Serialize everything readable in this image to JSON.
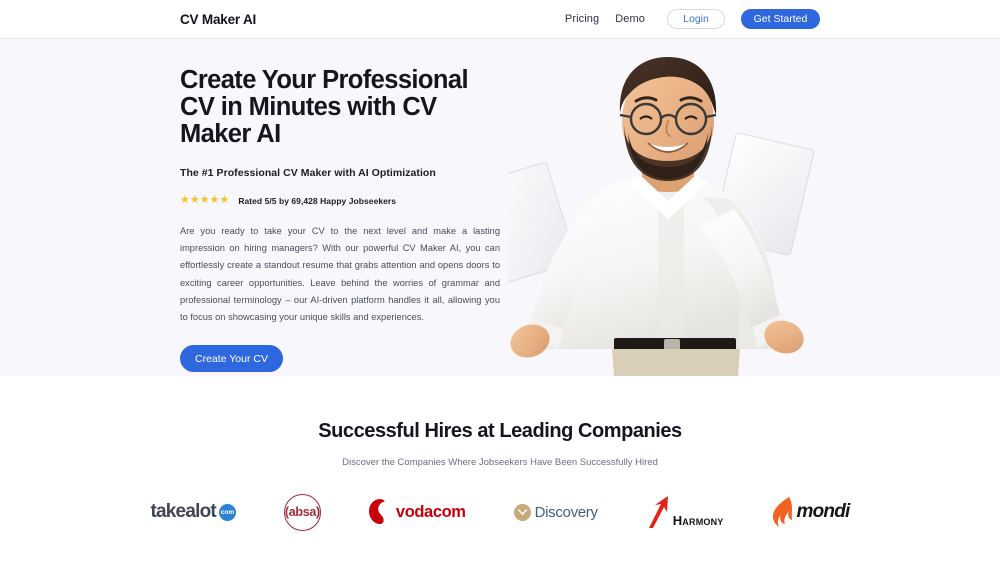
{
  "colors": {
    "accent_blue": "#2f67de",
    "hero_bg": "#f7f7fc",
    "page_bg": "#ffffff",
    "star_gold": "#f6c12b",
    "heading_dark": "#14161f",
    "body_gray": "#4a4e5e"
  },
  "header": {
    "brand": "CV Maker AI",
    "nav": [
      {
        "label": "Pricing"
      },
      {
        "label": "Demo"
      }
    ],
    "login_label": "Login",
    "get_started_label": "Get Started"
  },
  "hero": {
    "title": "Create Your Professional CV in Minutes with CV Maker AI",
    "subtitle": "The #1 Professional CV Maker with AI Optimization",
    "stars": "★★★★★",
    "rating_text": "Rated 5/5 by 69,428 Happy Jobseekers",
    "paragraph": "Are you ready to take your CV to the next level and make a lasting impression on hiring managers? With our powerful CV Maker AI, you can effortlessly create a standout resume that grabs attention and opens doors to exciting career opportunities. Leave behind the worries of grammar and professional terminology – our AI-driven platform handles it all, allowing you to focus on showcasing your unique skills and experiences.",
    "cta_label": "Create Your CV",
    "image_alt": "smiling-man-holding-documents"
  },
  "companies": {
    "title": "Successful Hires at Leading Companies",
    "subtitle": "Discover the Companies Where Jobseekers Have Been Successfully Hired",
    "logos": [
      {
        "name": "takealot",
        "text": "takealot",
        "badge": "com"
      },
      {
        "name": "absa",
        "text": "(absa)"
      },
      {
        "name": "vodacom",
        "text": "vodacom"
      },
      {
        "name": "discovery",
        "text": "Discovery"
      },
      {
        "name": "harmony",
        "text": "Harmony"
      },
      {
        "name": "mondi",
        "text": "mondi"
      }
    ]
  }
}
